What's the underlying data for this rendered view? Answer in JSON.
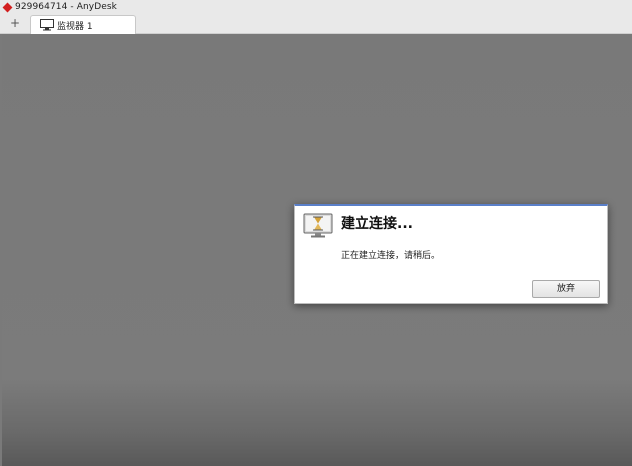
{
  "window": {
    "title": "929964714 - AnyDesk"
  },
  "tabs": [
    {
      "label": "监视器 1",
      "icon": "monitor-icon"
    }
  ],
  "new_tab_label": "+",
  "dialog": {
    "title": "建立连接...",
    "message": "正在建立连接，请稍后。",
    "cancel_label": "放弃",
    "icon": "hourglass-monitor-icon",
    "accent_color": "#5a7fc8"
  },
  "colors": {
    "app_brand": "#d21f1f",
    "remote_background": "#7a7a7a"
  }
}
